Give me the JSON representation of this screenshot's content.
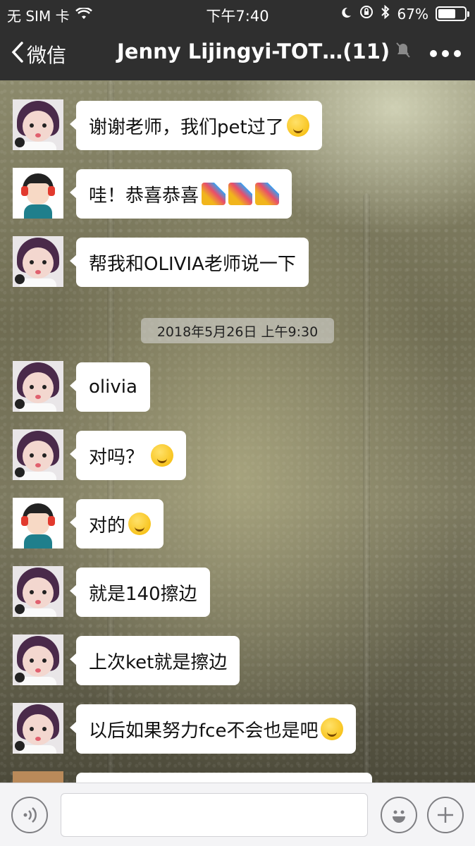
{
  "status_bar": {
    "carrier": "无 SIM 卡",
    "time": "下午7:40",
    "battery": "67%",
    "battery_level": 0.67,
    "icons": [
      "wifi-icon",
      "moon-icon",
      "rotation-lock-icon",
      "bluetooth-icon",
      "battery-icon"
    ]
  },
  "nav": {
    "back_label": "微信",
    "title": "Jenny Lijingyi-TOT…(11)",
    "icons": [
      "chevron-left-icon",
      "mute-bell-icon",
      "more-dots-icon"
    ]
  },
  "messages": [
    {
      "sender": "girl",
      "text": "谢谢老师，我们pet过了",
      "emoji": "hugging-face-emoji"
    },
    {
      "sender": "teacher",
      "text": "哇！恭喜恭喜",
      "emoji": "party-popper-emoji x3"
    },
    {
      "sender": "girl",
      "text": "帮我和OLIVIA老师说一下"
    },
    {
      "sender": "girl",
      "text": "olivia"
    },
    {
      "sender": "girl",
      "text": "对吗？",
      "emoji": "thinking-face-emoji"
    },
    {
      "sender": "teacher",
      "text": "对的",
      "emoji": "grinning-face-emoji"
    },
    {
      "sender": "girl",
      "text": "就是140擦边"
    },
    {
      "sender": "girl",
      "text": "上次ket就是擦边"
    },
    {
      "sender": "girl",
      "text": "以后如果努力fce不会也是吧",
      "emoji": "grimacing-face-emoji"
    }
  ],
  "timestamp": "2018年5月26日 上午9:30",
  "input_bar": {
    "icons": [
      "voice-icon",
      "emoji-icon",
      "plus-icon"
    ],
    "placeholder": ""
  },
  "colors": {
    "header_bg": "#2f2f2f",
    "bubble_bg": "#ffffff",
    "input_bar_bg": "#f4f4f6"
  }
}
